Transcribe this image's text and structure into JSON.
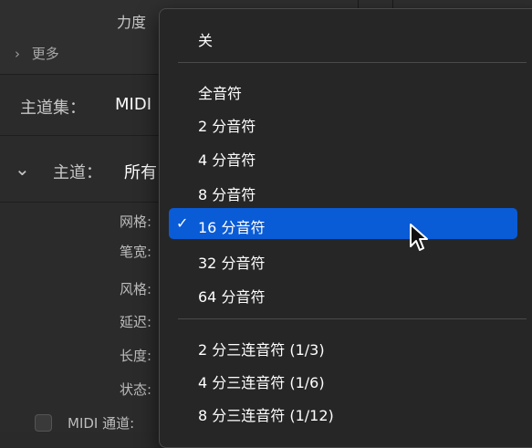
{
  "inspector": {
    "velocity_label": "力度",
    "more_label": "更多",
    "main_set_label": "主道集：",
    "main_set_value": "MIDI",
    "main_label": "主道：",
    "main_value": "所有",
    "params": [
      "网格:",
      "笔宽:",
      "风格:",
      "延迟:",
      "长度:",
      "状态:"
    ],
    "midi_channel_label": "MIDI 通道:"
  },
  "menu": {
    "off": "关",
    "notes": [
      "全音符",
      "2 分音符",
      "4 分音符",
      "8 分音符",
      "16 分音符",
      "32 分音符",
      "64 分音符"
    ],
    "selected_index": 4,
    "triplets": [
      "2 分三连音符 (1/3)",
      "4 分三连音符 (1/6)",
      "8 分三连音符 (1/12)"
    ]
  },
  "colors": {
    "selection": "#0a5bd6",
    "menu_bg": "#262626",
    "panel_bg": "#2b2b2b"
  }
}
